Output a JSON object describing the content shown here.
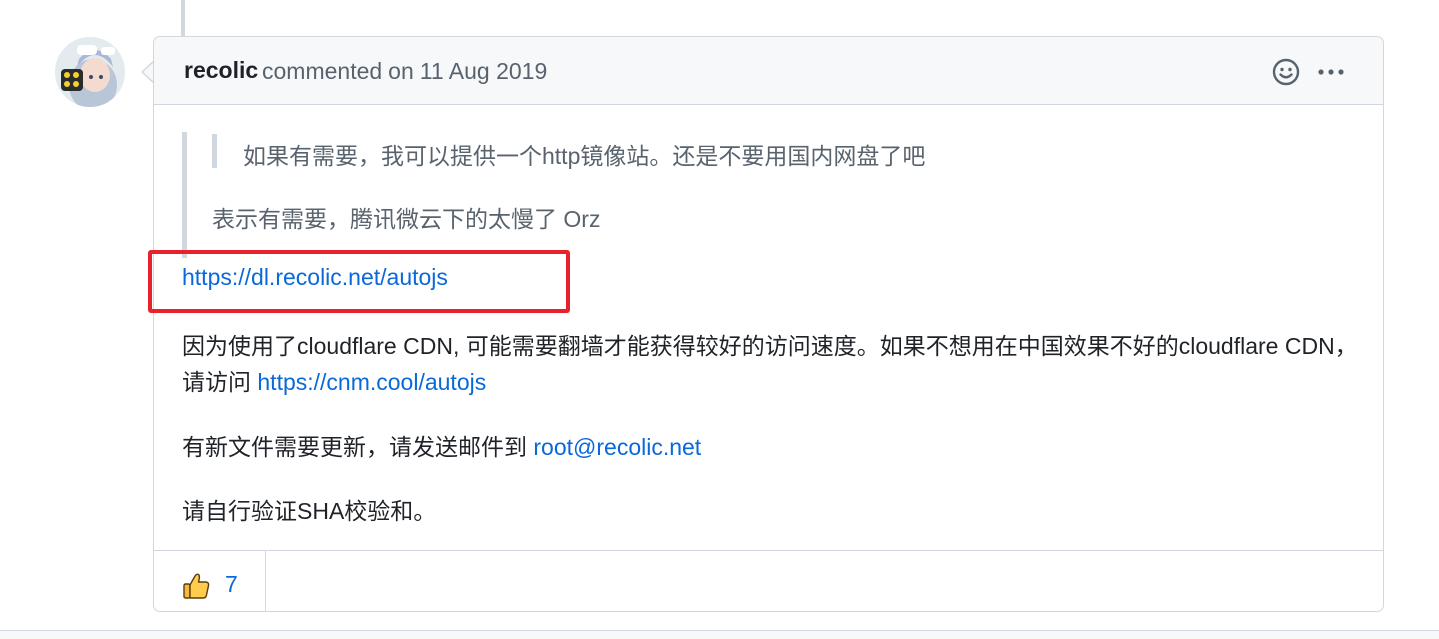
{
  "comment": {
    "author": "recolic",
    "action": "commented",
    "date_prefix": "on",
    "date": "11 Aug 2019",
    "quote": {
      "nested_line": "如果有需要，我可以提供一个http镜像站。还是不要用国内网盘了吧",
      "line": "表示有需要，腾讯微云下的太慢了 Orz"
    },
    "download_link": "https://dl.recolic.net/autojs",
    "cdn_note": "因为使用了cloudflare CDN, 可能需要翻墙才能获得较好的访问速度。如果不想用在中国效果不好的cloudflare CDN，请访问 ",
    "mirror_link": "https://cnm.cool/autojs",
    "update_note": "有新文件需要更新，请发送邮件到 ",
    "email": "root@recolic.net",
    "verify_note": "请自行验证SHA校验和。"
  },
  "reactions": [
    {
      "icon": "thumbs-up-icon",
      "emoji": "👍",
      "count": "7"
    }
  ],
  "icons": {
    "add_reaction": "smiley-icon",
    "more_options": "kebab-horizontal-icon"
  },
  "colors": {
    "link": "#0969da",
    "highlight_border": "#e8222b",
    "header_bg": "#f6f8fa",
    "border": "#d0d7de",
    "muted_text": "#59636e"
  }
}
